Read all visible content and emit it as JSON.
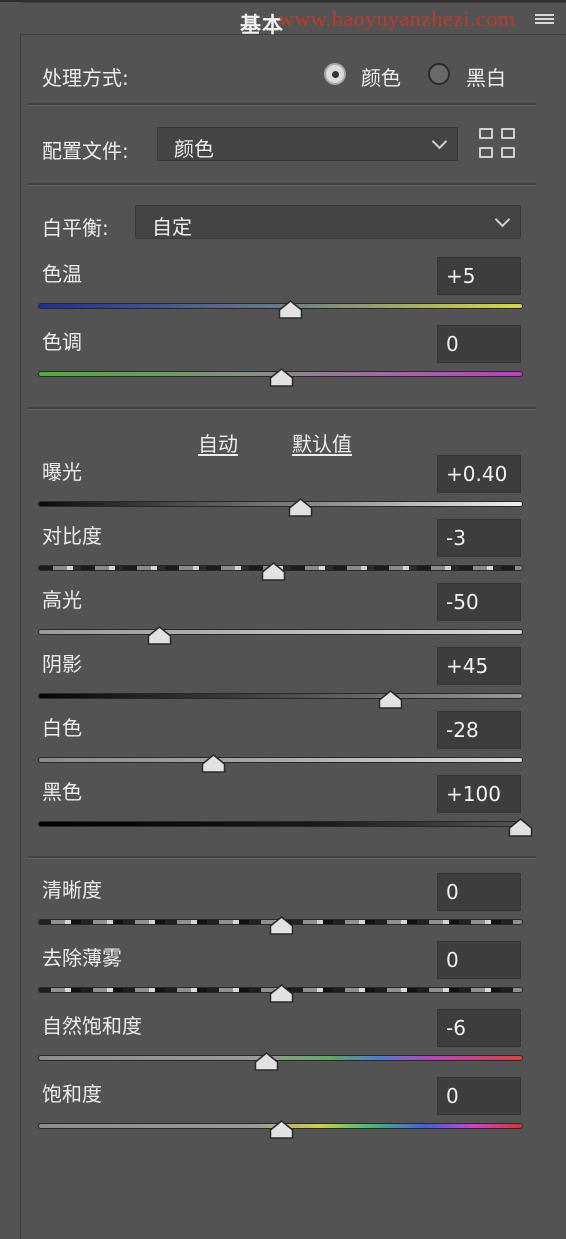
{
  "header": {
    "title": "基本",
    "watermark": "www.haoyuyanzhezi.com"
  },
  "process": {
    "label": "处理方式:",
    "options": [
      {
        "label": "颜色",
        "selected": true
      },
      {
        "label": "黑白",
        "selected": false
      }
    ]
  },
  "profile": {
    "label": "配置文件:",
    "value": "颜色"
  },
  "white_balance": {
    "label": "白平衡:",
    "value": "自定"
  },
  "auto": {
    "auto_label": "自动",
    "default_label": "默认值"
  },
  "sliders": [
    {
      "label": "色温",
      "value": "+5",
      "level": 0.52
    },
    {
      "label": "色调",
      "value": "0",
      "level": 0.5
    },
    {
      "label": "曝光",
      "value": "+0.40",
      "level": 0.54
    },
    {
      "label": "对比度",
      "value": "-3",
      "level": 0.485
    },
    {
      "label": "高光",
      "value": "-50",
      "level": 0.25
    },
    {
      "label": "阴影",
      "value": "+45",
      "level": 0.725
    },
    {
      "label": "白色",
      "value": "-28",
      "level": 0.36
    },
    {
      "label": "黑色",
      "value": "+100",
      "level": 1.0
    },
    {
      "label": "清晰度",
      "value": "0",
      "level": 0.5
    },
    {
      "label": "去除薄雾",
      "value": "0",
      "level": 0.5
    },
    {
      "label": "自然饱和度",
      "value": "-6",
      "level": 0.47
    },
    {
      "label": "饱和度",
      "value": "0",
      "level": 0.5
    }
  ]
}
